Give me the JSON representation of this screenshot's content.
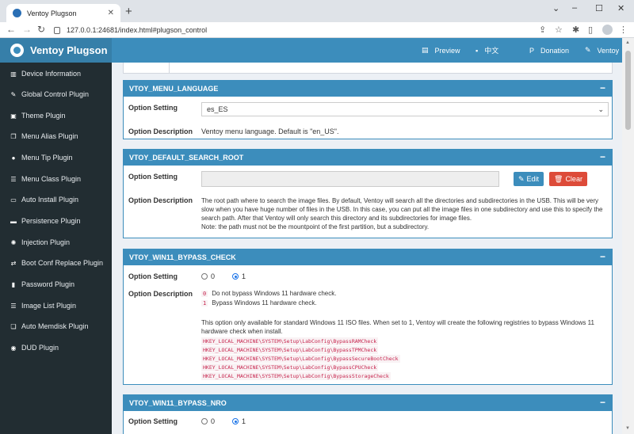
{
  "browser": {
    "tab_title": "Ventoy Plugson",
    "url": "127.0.0.1:24681/index.html#plugson_control"
  },
  "header": {
    "logo_text": "Ventoy Plugson",
    "nav": [
      {
        "label": "Preview",
        "icon": "preview-icon"
      },
      {
        "label": "中文",
        "icon": "language-icon"
      },
      {
        "label": "Donation",
        "icon": "paypal-icon"
      },
      {
        "label": "Ventoy",
        "icon": "wrench-icon"
      }
    ]
  },
  "sidebar": {
    "items": [
      {
        "label": "Device Information",
        "icon": "bank-icon"
      },
      {
        "label": "Global Control Plugin",
        "icon": "wrench-icon"
      },
      {
        "label": "Theme Plugin",
        "icon": "image-icon"
      },
      {
        "label": "Menu Alias Plugin",
        "icon": "copy-icon"
      },
      {
        "label": "Menu Tip Plugin",
        "icon": "comment-icon"
      },
      {
        "label": "Menu Class Plugin",
        "icon": "list-icon"
      },
      {
        "label": "Auto Install Plugin",
        "icon": "desktop-icon"
      },
      {
        "label": "Persistence Plugin",
        "icon": "hdd-icon"
      },
      {
        "label": "Injection Plugin",
        "icon": "cog-icon"
      },
      {
        "label": "Boot Conf Replace Plugin",
        "icon": "exchange-icon"
      },
      {
        "label": "Password Plugin",
        "icon": "lock-icon"
      },
      {
        "label": "Image List Plugin",
        "icon": "list-icon"
      },
      {
        "label": "Auto Memdisk Plugin",
        "icon": "clone-icon"
      },
      {
        "label": "DUD Plugin",
        "icon": "dot-circle-icon"
      }
    ]
  },
  "labels": {
    "option_setting": "Option Setting",
    "option_description": "Option Description"
  },
  "menu_language": {
    "title": "VTOY_MENU_LANGUAGE",
    "selected": "es_ES",
    "description": "Ventoy menu language. Default is \"en_US\"."
  },
  "default_search_root": {
    "title": "VTOY_DEFAULT_SEARCH_ROOT",
    "value": "",
    "edit_label": "Edit",
    "clear_label": "Clear",
    "description": "The root path where to search the image files. By default, Ventoy will search all the directories and subdirectories in the USB. This will be very slow when you have huge number of files in the USB. In this case, you can put all the image files in one subdirectory and use this to specify the search path. After that Ventoy will only search this directory and its subdirectories for image files.",
    "note": "Note: the path must not be the mountpoint of the first partition, but a subdirectory."
  },
  "win11_bypass_check": {
    "title": "VTOY_WIN11_BYPASS_CHECK",
    "options": [
      "0",
      "1"
    ],
    "selected": "1",
    "opt0_code": "0",
    "opt0_text": "Do not bypass Windows 11 hardware check.",
    "opt1_code": "1",
    "opt1_text": "Bypass Windows 11 hardware check.",
    "description": "This option only available for standard Windows 11 ISO files. When set to 1, Ventoy will create the following registries to bypass Windows 11 hardware check when install.",
    "registries": [
      "HKEY_LOCAL_MACHINE\\SYSTEM\\Setup\\LabConfig\\BypassRAMCheck",
      "HKEY_LOCAL_MACHINE\\SYSTEM\\Setup\\LabConfig\\BypassTPMCheck",
      "HKEY_LOCAL_MACHINE\\SYSTEM\\Setup\\LabConfig\\BypassSecureBootCheck",
      "HKEY_LOCAL_MACHINE\\SYSTEM\\Setup\\LabConfig\\BypassCPUCheck",
      "HKEY_LOCAL_MACHINE\\SYSTEM\\Setup\\LabConfig\\BypassStorageCheck"
    ]
  },
  "win11_bypass_nro": {
    "title": "VTOY_WIN11_BYPASS_NRO",
    "options": [
      "0",
      "1"
    ],
    "selected": "1"
  },
  "colors": {
    "header": "#3c8dbc",
    "sidebar": "#222d32",
    "danger": "#dd4b39"
  }
}
